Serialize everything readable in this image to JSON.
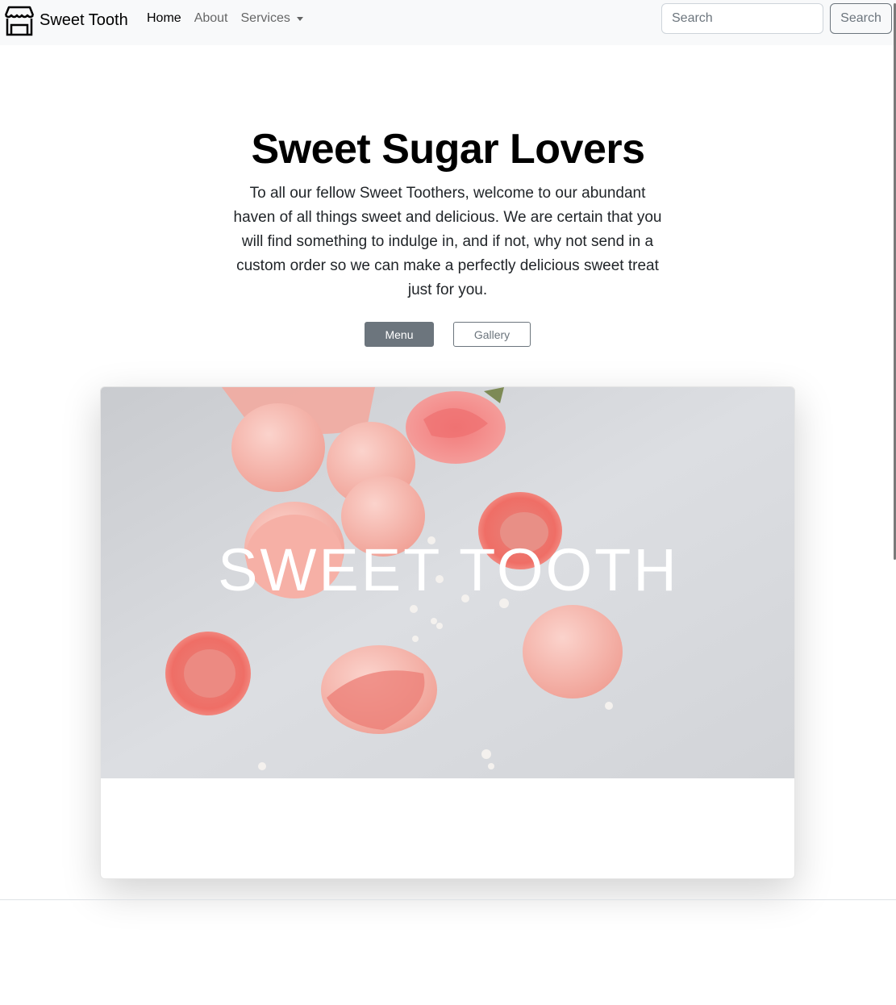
{
  "navbar": {
    "brand": "Sweet Tooth",
    "brand_icon": "shop-icon",
    "links": [
      {
        "label": "Home",
        "active": true
      },
      {
        "label": "About",
        "active": false
      },
      {
        "label": "Services",
        "active": false,
        "dropdown": true
      }
    ],
    "search": {
      "placeholder": "Search",
      "button_label": "Search"
    }
  },
  "hero": {
    "title": "Sweet Sugar Lovers",
    "lead": "To all our fellow Sweet Toothers, welcome to our abundant haven of all things sweet and delicious. We are certain that you will find something to indulge in, and if not, why not send in a custom order so we can make a perfectly delicious sweet treat just for you.",
    "primary_button": "Menu",
    "secondary_button": "Gallery"
  },
  "card": {
    "image_overlay_text": "SWEET TOOTH"
  },
  "colors": {
    "navbar_bg": "#f8f9fa",
    "secondary": "#6c757d",
    "macaron_pink": "#f4a9a0",
    "macaron_coral": "#ec7b73"
  }
}
